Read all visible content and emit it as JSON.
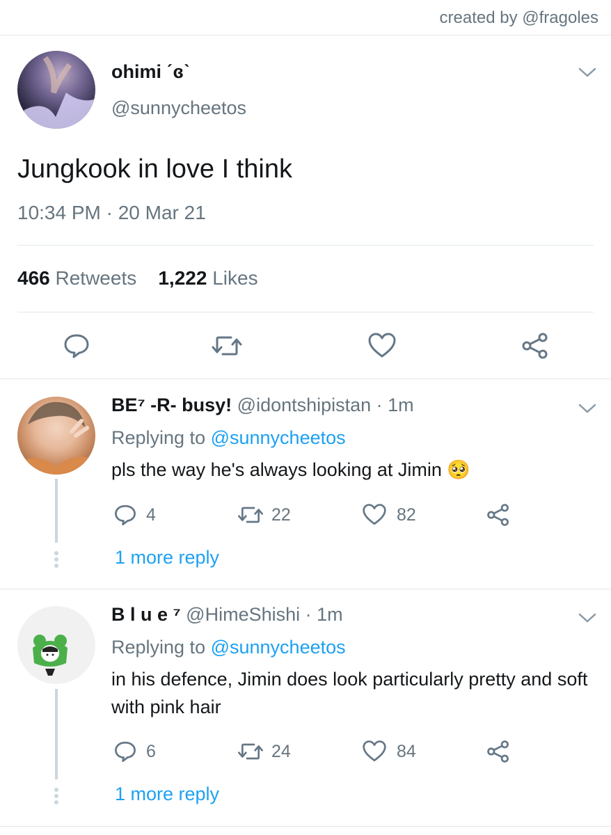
{
  "credit": "created by @fragoles",
  "tweet": {
    "display_name": "ohimi ˊɞˋ",
    "handle": "@sunnycheetos",
    "text": "Jungkook in love I think",
    "timestamp": "10:34 PM · 20 Mar 21",
    "retweets_count": "466",
    "retweets_label": "Retweets",
    "likes_count": "1,222",
    "likes_label": "Likes"
  },
  "replies": [
    {
      "display_name": "BE⁷ -R- busy!",
      "handle": "@idontshipistan · 1m",
      "replying_prefix": "Replying to ",
      "replying_to": "@sunnycheetos",
      "text": "pls the way he's always looking at Jimin 🥺",
      "reply_count": "4",
      "retweet_count": "22",
      "like_count": "82",
      "more": "1 more reply"
    },
    {
      "display_name": "B l u e ⁷",
      "handle": "@HimeShishi · 1m",
      "replying_prefix": "Replying to ",
      "replying_to": "@sunnycheetos",
      "text": "in his defence, Jimin does look particularly pretty and soft with pink hair",
      "reply_count": "6",
      "retweet_count": "24",
      "like_count": "84",
      "more": "1 more reply"
    }
  ],
  "icons": {
    "reply": "speech-bubble-icon",
    "retweet": "retweet-arrows-icon",
    "like": "heart-icon",
    "share": "share-nodes-icon",
    "menu": "chevron-down-icon"
  },
  "colors": {
    "link": "#1da1f2",
    "secondary_text": "#66757f",
    "divider": "#e1e8ed",
    "icon": "#657786"
  }
}
